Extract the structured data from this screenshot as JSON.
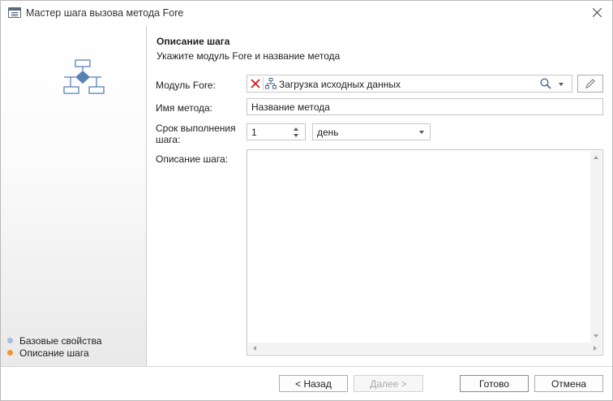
{
  "window": {
    "title": "Мастер шага вызова метода Fore",
    "icon": "wizard-window-icon",
    "close_icon": "close-icon"
  },
  "header": {
    "title": "Описание шага",
    "subtitle": "Укажите модуль Fore и название метода"
  },
  "form": {
    "module": {
      "label": "Модуль Fore:",
      "value": "Загрузка исходных данных",
      "clear_icon": "clear-red-x-icon",
      "module_icon": "module-tree-icon",
      "search_icon": "search-icon",
      "edit_icon": "pencil-icon"
    },
    "method": {
      "label": "Имя метода:",
      "value": "Название метода"
    },
    "term": {
      "label_line1": "Срок выполнения",
      "label_line2": "шага:",
      "value": "1",
      "unit": "день"
    },
    "description": {
      "label": "Описание шага:",
      "value": ""
    }
  },
  "steps": [
    {
      "label": "Базовые свойства",
      "state": "done",
      "color": "#a7bde3"
    },
    {
      "label": "Описание шага",
      "state": "current",
      "color": "#f29433"
    }
  ],
  "buttons": {
    "back": "< Назад",
    "next": "Далее >",
    "finish": "Готово",
    "cancel": "Отмена"
  },
  "colors": {
    "accent_current": "#f29433",
    "accent_done": "#a7bde3",
    "flow_icon": "#5b82b5"
  }
}
